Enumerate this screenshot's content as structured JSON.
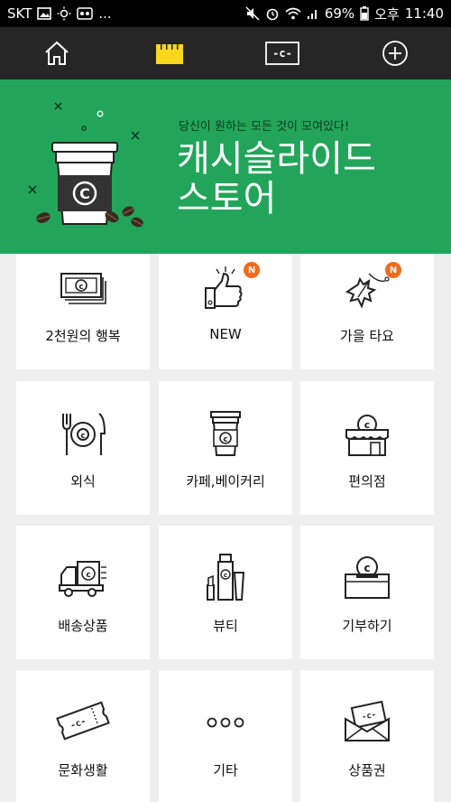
{
  "status_bar": {
    "carrier": "SKT",
    "dots": "...",
    "battery": "69%",
    "ampm": "오후",
    "time": "11:40"
  },
  "top_nav": {
    "items": [
      {
        "icon": "home-icon"
      },
      {
        "icon": "store-icon",
        "active": true
      },
      {
        "icon": "cash-card-icon"
      },
      {
        "icon": "plus-circle-icon"
      }
    ],
    "accent": "#f9d71c"
  },
  "banner": {
    "subtitle": "당신이 원하는 모든 것이 모여있다!",
    "title_line1": "캐시슬라이드",
    "title_line2": "스토어",
    "bg_color": "#22a55a"
  },
  "categories": [
    {
      "label": "2천원의 행복",
      "icon": "banknote-icon",
      "badge": ""
    },
    {
      "label": "NEW",
      "icon": "thumbs-up-icon",
      "badge": "N"
    },
    {
      "label": "가을 타요",
      "icon": "autumn-leaf-icon",
      "badge": "N"
    },
    {
      "label": "외식",
      "icon": "dining-icon",
      "badge": ""
    },
    {
      "label": "카페,베이커리",
      "icon": "coffee-cup-icon",
      "badge": ""
    },
    {
      "label": "편의점",
      "icon": "convenience-store-icon",
      "badge": ""
    },
    {
      "label": "배송상품",
      "icon": "delivery-truck-icon",
      "badge": ""
    },
    {
      "label": "뷰티",
      "icon": "cosmetics-icon",
      "badge": ""
    },
    {
      "label": "기부하기",
      "icon": "donation-box-icon",
      "badge": ""
    },
    {
      "label": "문화생활",
      "icon": "ticket-icon",
      "badge": ""
    },
    {
      "label": "기타",
      "icon": "more-dots-icon",
      "badge": ""
    },
    {
      "label": "상품권",
      "icon": "gift-card-envelope-icon",
      "badge": ""
    }
  ]
}
